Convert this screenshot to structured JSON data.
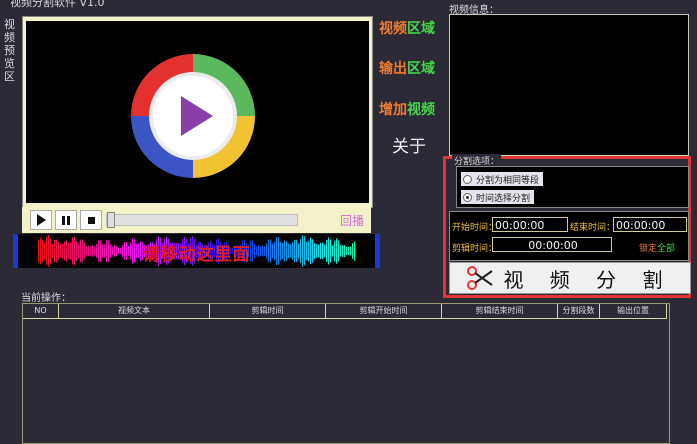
{
  "window": {
    "title": "视频分割软件 V1.0"
  },
  "preview_label": "视频预览区",
  "player": {
    "replay_label": "回播"
  },
  "waveform": {
    "hint": "请移动这里面"
  },
  "menu": {
    "video_area": {
      "a": "视频",
      "b": "区域"
    },
    "output_area": {
      "a": "输出",
      "b": "区域"
    },
    "add_video": {
      "a": "增加",
      "b": "视频"
    },
    "about": "关于"
  },
  "video_info": {
    "label": "视频信息："
  },
  "split_mode": {
    "label": "分割选项：",
    "options": [
      {
        "label": "分割为相同等段",
        "selected": false
      },
      {
        "label": "时间选择分割",
        "selected": true
      }
    ]
  },
  "time": {
    "start_label": "开始时间：",
    "start_value": "00:00:00",
    "end_label": "结束时间：",
    "end_value": "00:00:00",
    "clip_label": "剪辑时间：",
    "clip_value": "00:00:00",
    "lock_a": "锁定",
    "lock_b": "全部"
  },
  "split_button": {
    "label": "视 频 分 割"
  },
  "operations": {
    "label": "当前操作：",
    "columns": [
      "NO",
      "视频文本",
      "剪辑时间",
      "剪辑开始时间",
      "剪辑结束时间",
      "分割段数",
      "输出位置"
    ]
  },
  "colors": {
    "background": "#2b2a36",
    "highlight_border": "#e03535",
    "menu_orange": "#f07a30",
    "menu_green": "#45d64a",
    "waveform_text": "#e61b1b",
    "replay": "#d070d8"
  }
}
